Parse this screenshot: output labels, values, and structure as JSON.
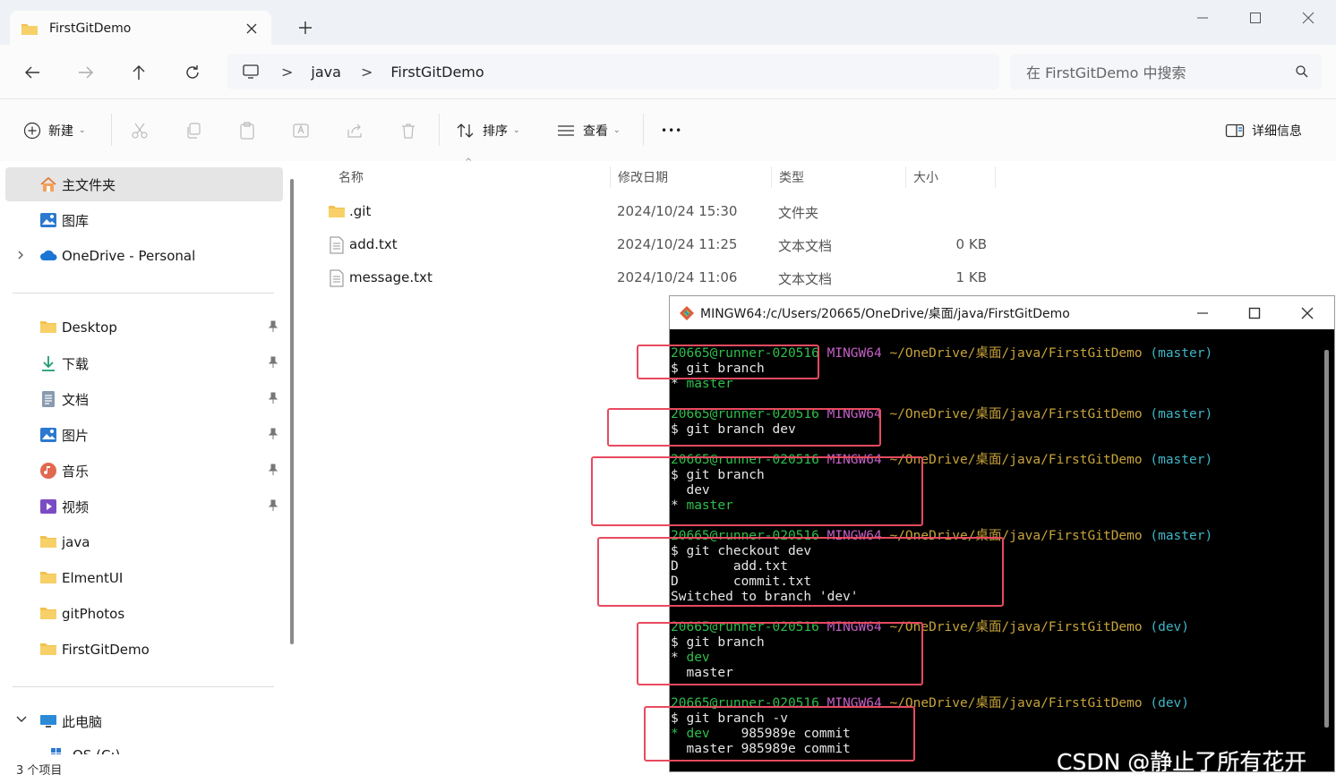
{
  "window": {
    "tab_title": "FirstGitDemo",
    "new_tab": "+",
    "minimize": "—",
    "maximize": "☐",
    "close": "✕"
  },
  "nav": {
    "breadcrumb": [
      "java",
      "FirstGitDemo"
    ],
    "breadcrumb_sep": ">",
    "search_placeholder": "在 FirstGitDemo 中搜索"
  },
  "toolbar": {
    "new_label": "新建",
    "sort_label": "排序",
    "view_label": "查看",
    "more_label": "•••",
    "details_label": "详细信息"
  },
  "sidebar": {
    "items": [
      {
        "label": "主文件夹",
        "icon": "home-icon"
      },
      {
        "label": "图库",
        "icon": "gallery-icon"
      },
      {
        "label": "OneDrive - Personal",
        "icon": "cloud-icon"
      },
      {
        "label": "Desktop",
        "icon": "folder-icon"
      },
      {
        "label": "下载",
        "icon": "download-icon"
      },
      {
        "label": "文档",
        "icon": "document-icon"
      },
      {
        "label": "图片",
        "icon": "pictures-icon"
      },
      {
        "label": "音乐",
        "icon": "music-icon"
      },
      {
        "label": "视频",
        "icon": "video-icon"
      },
      {
        "label": "java",
        "icon": "folder-icon"
      },
      {
        "label": "ElmentUI",
        "icon": "folder-icon"
      },
      {
        "label": "gitPhotos",
        "icon": "folder-icon"
      },
      {
        "label": "FirstGitDemo",
        "icon": "folder-icon"
      },
      {
        "label": "此电脑",
        "icon": "computer-icon"
      },
      {
        "label": "OS (C:)",
        "icon": "drive-icon"
      }
    ]
  },
  "status": {
    "items_count": "3 个项目"
  },
  "files": {
    "columns": [
      "名称",
      "修改日期",
      "类型",
      "大小"
    ],
    "rows": [
      {
        "name": ".git",
        "date": "2024/10/24 15:30",
        "type": "文件夹",
        "size": ""
      },
      {
        "name": "add.txt",
        "date": "2024/10/24 11:25",
        "type": "文本文档",
        "size": "0 KB"
      },
      {
        "name": "message.txt",
        "date": "2024/10/24 11:06",
        "type": "文本文档",
        "size": "1 KB"
      }
    ]
  },
  "terminal": {
    "title": "MINGW64:/c/Users/20665/OneDrive/桌面/java/FirstGitDemo",
    "user": "20665@runner-020516",
    "env": "MINGW64",
    "path": "~/OneDrive/桌面/java/FirstGitDemo",
    "blocks": [
      {
        "branch": "(master)",
        "lines": [
          {
            "text": "$ git branch",
            "color": "white"
          },
          {
            "text": "* master",
            "color": "green"
          }
        ]
      },
      {
        "branch": "(master)",
        "lines": [
          {
            "text": "$ git branch dev",
            "color": "white"
          }
        ]
      },
      {
        "branch": "(master)",
        "lines": [
          {
            "text": "$ git branch",
            "color": "white"
          },
          {
            "text": "  dev",
            "color": "white"
          },
          {
            "text": "* master",
            "color": "green"
          }
        ]
      },
      {
        "branch": "(master)",
        "lines": [
          {
            "text": "$ git checkout dev",
            "color": "white"
          },
          {
            "text": "D       add.txt",
            "color": "white"
          },
          {
            "text": "D       commit.txt",
            "color": "white"
          },
          {
            "text": "Switched to branch 'dev'",
            "color": "white"
          }
        ]
      },
      {
        "branch": "(dev)",
        "lines": [
          {
            "text": "$ git branch",
            "color": "white"
          },
          {
            "text": "* dev",
            "color": "green"
          },
          {
            "text": "  master",
            "color": "white"
          }
        ]
      },
      {
        "branch": "(dev)",
        "lines": [
          {
            "text": "$ git branch -v",
            "color": "white"
          },
          {
            "text": "* dev    985989e commit",
            "color": "mixed"
          },
          {
            "text": "  master 985989e commit",
            "color": "white"
          }
        ]
      }
    ]
  },
  "watermark": "CSDN @静止了所有花开",
  "colors": {
    "accent": "#0067c0",
    "term_green": "#2fbe4b",
    "term_magenta": "#c55fc7",
    "term_yellow": "#c7a33a",
    "term_cyan": "#3fb6c7",
    "annotation_red": "#e84a5f"
  }
}
